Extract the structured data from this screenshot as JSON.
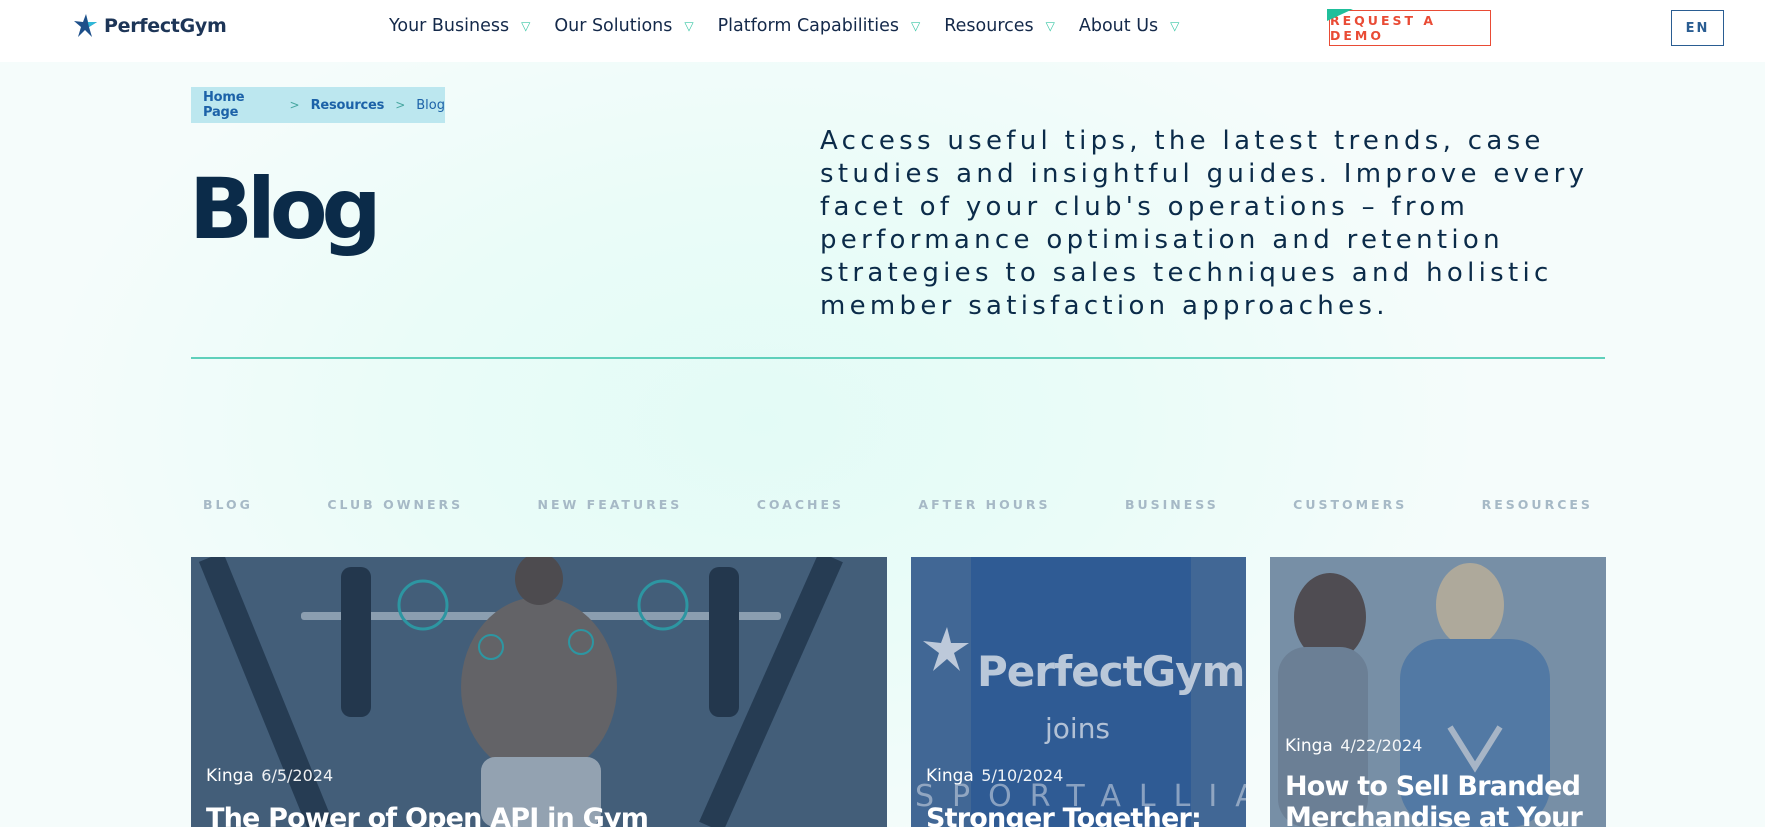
{
  "header": {
    "logo_text": "PerfectGym",
    "nav": [
      {
        "label": "Your Business"
      },
      {
        "label": "Our Solutions"
      },
      {
        "label": "Platform Capabilities"
      },
      {
        "label": "Resources"
      },
      {
        "label": "About Us"
      }
    ],
    "demo_label": "REQUEST A DEMO",
    "lang_label": "EN",
    "chevron": "▽"
  },
  "breadcrumb": {
    "home": "Home Page",
    "resources": "Resources",
    "current": "Blog",
    "separator": ">"
  },
  "page": {
    "title": "Blog",
    "intro": "Access useful tips, the latest trends, case studies and insightful guides. Improve every facet of your club's operations – from performance optimisation and retention strategies to sales techniques and holistic member satisfaction approaches."
  },
  "categories": [
    "BLOG",
    "CLUB OWNERS",
    "NEW FEATURES",
    "COACHES",
    "AFTER HOURS",
    "BUSINESS",
    "CUSTOMERS",
    "RESOURCES"
  ],
  "posts": [
    {
      "author": "Kinga",
      "date": "6/5/2024",
      "title": "The Power of Open API in Gym"
    },
    {
      "author": "Kinga",
      "date": "5/10/2024",
      "title": "Stronger Together:",
      "image_logo": "PerfectGym",
      "image_text_1": "joins",
      "image_text_2": "SPORTALLIANC"
    },
    {
      "author": "Kinga",
      "date": "4/22/2024",
      "title": "How to Sell Branded Merchandise at Your"
    }
  ],
  "colors": {
    "navy": "#0b2b49",
    "accent_green": "#3cc7a6",
    "demo_red": "#e94b35",
    "lang_blue": "#2a5d92",
    "breadcrumb_bg": "#bce7ef"
  }
}
